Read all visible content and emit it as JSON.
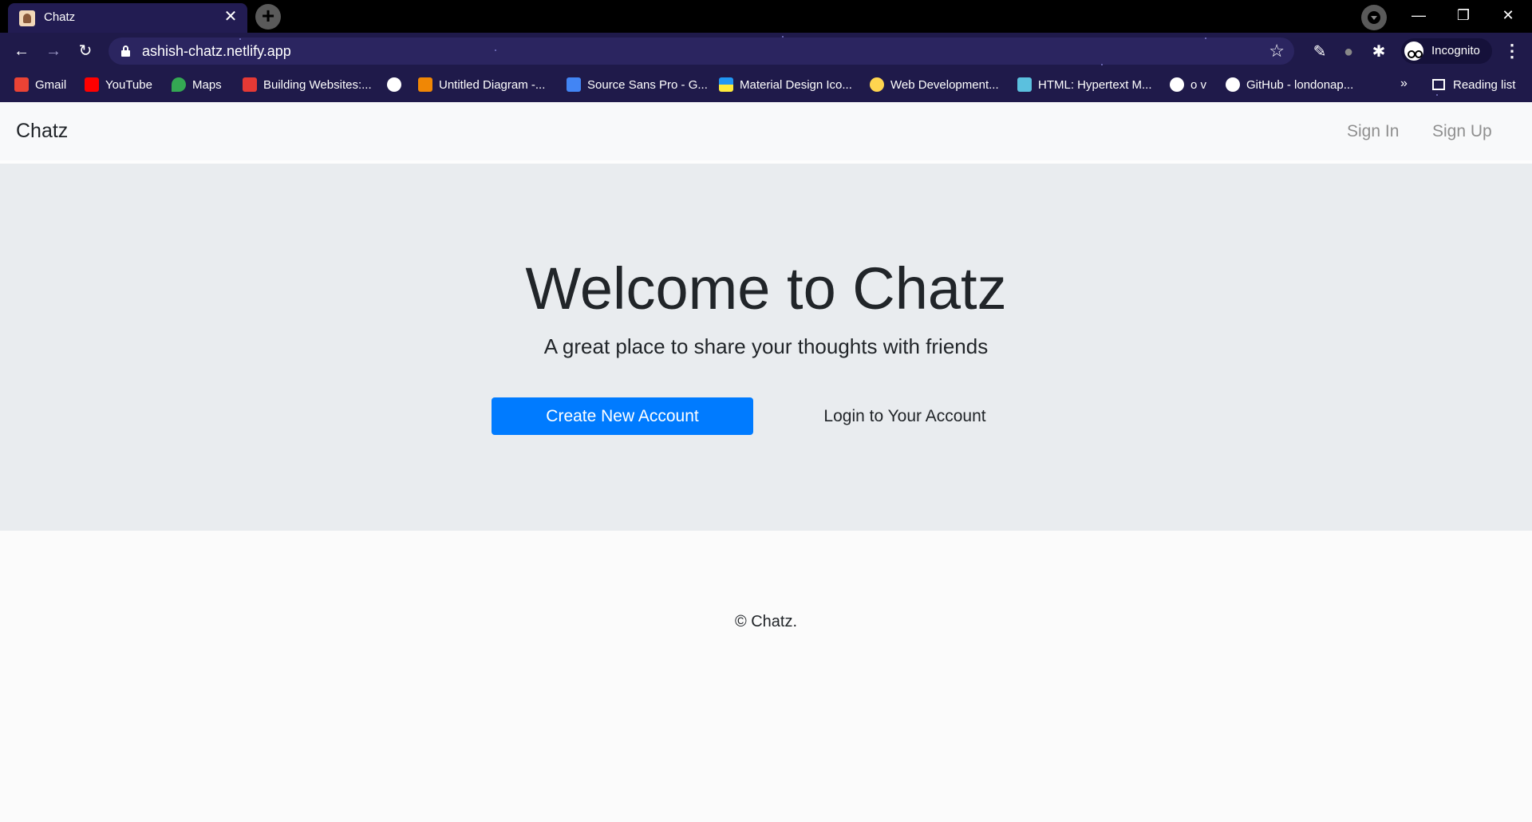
{
  "browser": {
    "tab_title": "Chatz",
    "tab_close": "✕",
    "new_tab": "+",
    "url": "ashish-chatz.netlify.app",
    "profile_label": "Incognito",
    "window_controls": {
      "minimize": "—",
      "restore": "❐",
      "close": "✕"
    },
    "bookmarks": [
      {
        "label": "Gmail",
        "icon_color": "#ea4335"
      },
      {
        "label": "YouTube",
        "icon_color": "#ff0000"
      },
      {
        "label": "Maps",
        "icon_color": "#34a853"
      },
      {
        "label": "Building Websites:...",
        "icon_color": "#e53935"
      },
      {
        "label": "",
        "icon_color": "#ffffff"
      },
      {
        "label": "Untitled Diagram -...",
        "icon_color": "#f08705"
      },
      {
        "label": "Source Sans Pro - G...",
        "icon_color": "#4285f4"
      },
      {
        "label": "Material Design Ico...",
        "icon_color": "#2196f3"
      },
      {
        "label": "Web Development...",
        "icon_color": "#ffd54f"
      },
      {
        "label": "HTML: Hypertext M...",
        "icon_color": "#5bc0de"
      },
      {
        "label": "o v",
        "icon_color": "#ffffff"
      },
      {
        "label": "GitHub - londonap...",
        "icon_color": "#ffffff"
      }
    ],
    "bookmarks_more": "»",
    "reading_list": "Reading list"
  },
  "site": {
    "brand": "Chatz",
    "nav": {
      "sign_in": "Sign In",
      "sign_up": "Sign Up"
    },
    "hero": {
      "title": "Welcome to Chatz",
      "subtitle": "A great place to share your thoughts with friends",
      "primary_button": "Create New Account",
      "secondary_button": "Login to Your Account"
    },
    "footer": "© Chatz."
  },
  "colors": {
    "browser_frame": "#1f1a4a",
    "primary_button": "#007bff",
    "hero_background": "#e9ecef",
    "navbar_background": "#f8f9fa"
  }
}
